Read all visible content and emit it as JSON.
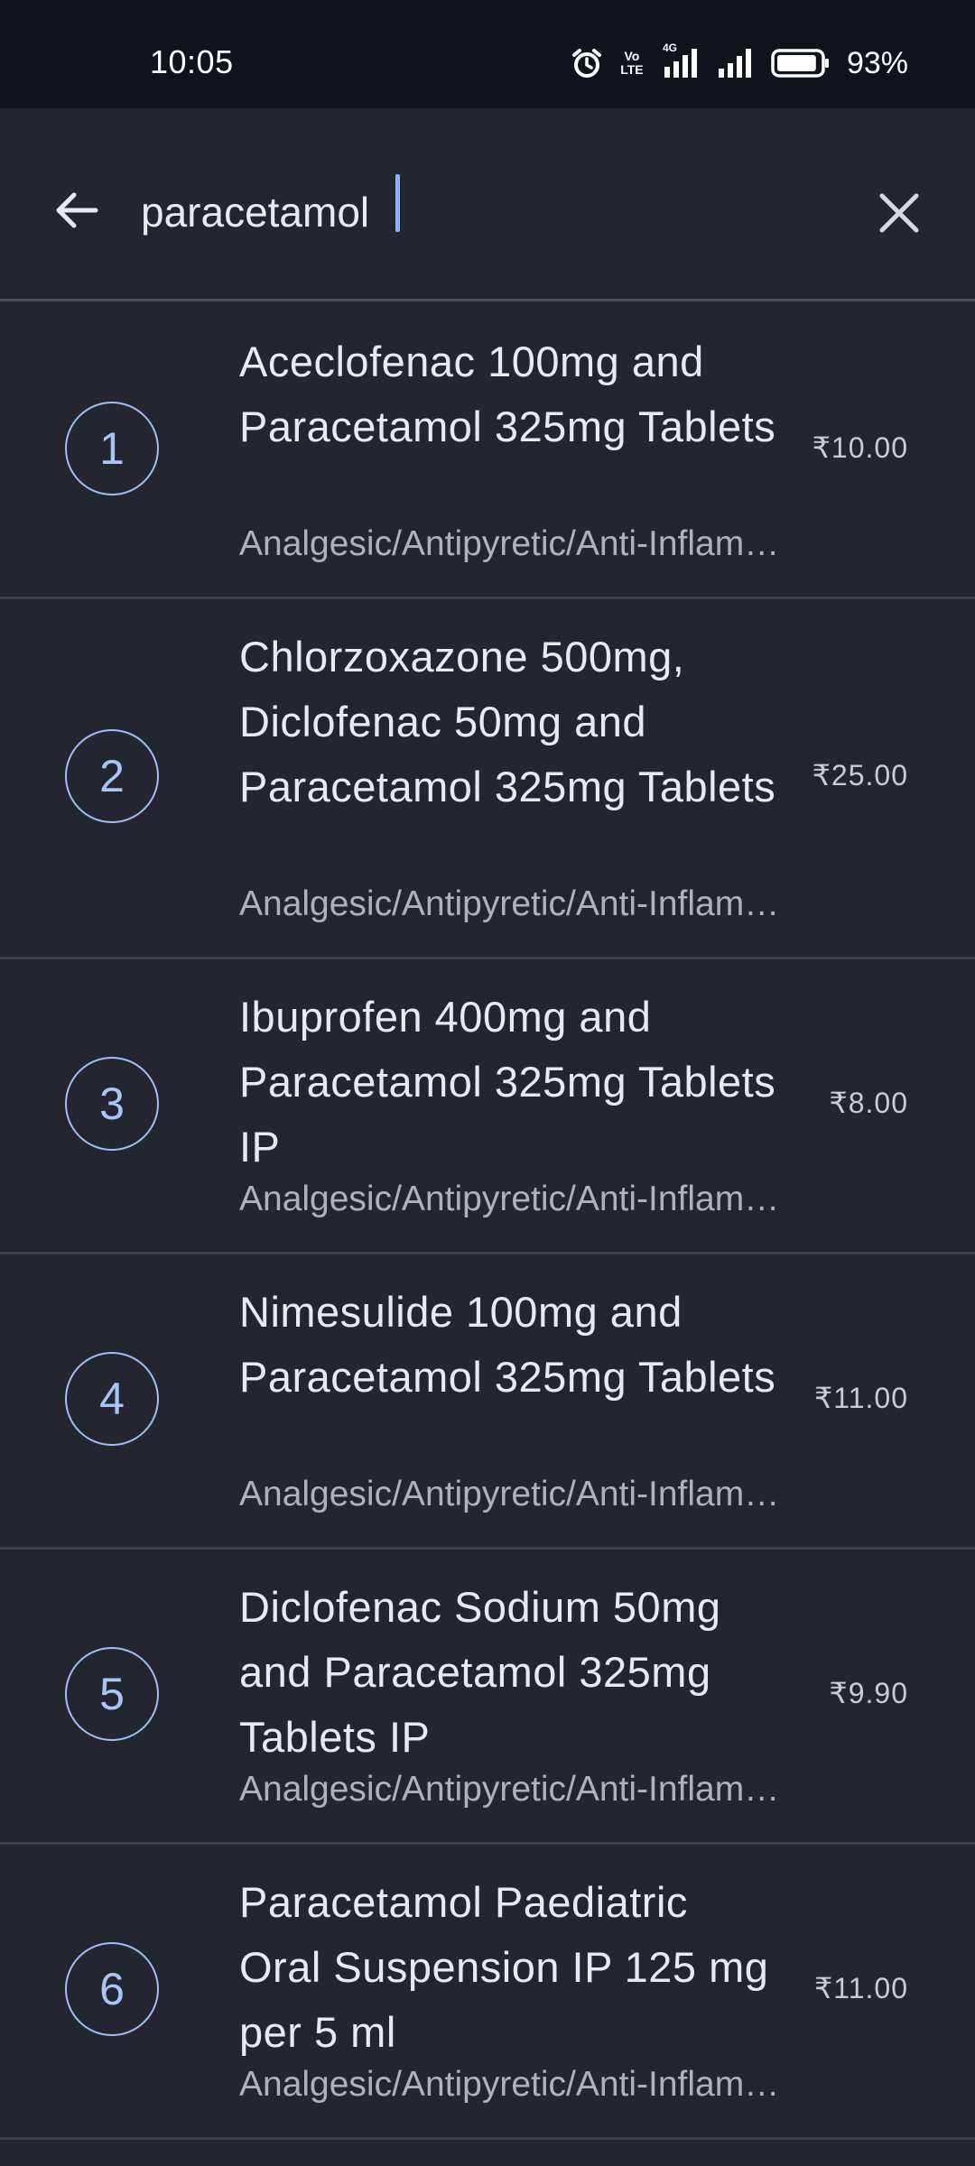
{
  "status_bar": {
    "time": "10:05",
    "volte_label": "Vo\nLTE",
    "network_label": "4G",
    "battery_percent": "93%",
    "battery_level": 0.93,
    "icons": [
      "alarm-icon",
      "volte-icon",
      "signal-4g-icon",
      "signal-icon",
      "battery-icon"
    ]
  },
  "search": {
    "value": "paracetamol",
    "back_icon": "arrow-left-icon",
    "clear_icon": "close-icon",
    "accent_color": "#8fb4ff"
  },
  "results": [
    {
      "index": "1",
      "name": "Aceclofenac 100mg and Paracetamol 325mg Tablets",
      "category": "Analgesic/Antipyretic/Anti-Inflammatory",
      "price": "₹10.00",
      "lines": 3
    },
    {
      "index": "2",
      "name": "Chlorzoxazone 500mg, Diclofenac 50mg and Paracetamol 325mg Tablets",
      "category": "Analgesic/Antipyretic/Anti-Inflammatory",
      "price": "₹25.00",
      "lines": 4
    },
    {
      "index": "3",
      "name": "Ibuprofen 400mg and Paracetamol 325mg Tablets IP",
      "category": "Analgesic/Antipyretic/Anti-Inflammatory",
      "price": "₹8.00",
      "lines": 3
    },
    {
      "index": "4",
      "name": "Nimesulide 100mg and Paracetamol 325mg Tablets",
      "category": "Analgesic/Antipyretic/Anti-Inflammatory",
      "price": "₹11.00",
      "lines": 3
    },
    {
      "index": "5",
      "name": "Diclofenac Sodium 50mg and Paracetamol 325mg Tablets IP",
      "category": "Analgesic/Antipyretic/Anti-Inflammatory",
      "price": "₹9.90",
      "lines": 3
    },
    {
      "index": "6",
      "name": "Paracetamol Paediatric Oral Suspension IP 125 mg per 5 ml",
      "category": "Analgesic/Antipyretic/Anti-Inflammatory",
      "price": "₹11.00",
      "lines": 3
    }
  ]
}
